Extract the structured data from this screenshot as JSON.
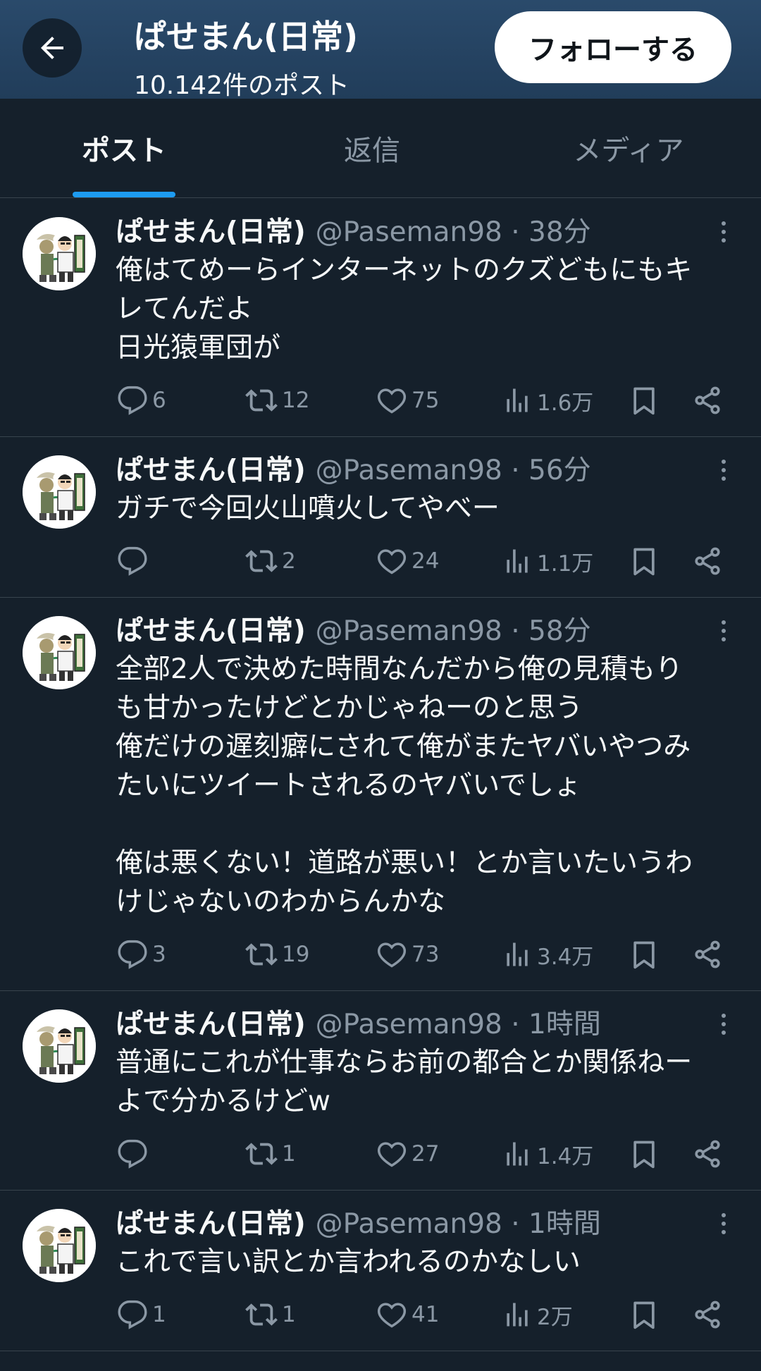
{
  "header": {
    "title": "ぱせまん(日常)",
    "subtitle": "10.142件のポスト",
    "follow_label": "フォローする"
  },
  "tabs": [
    {
      "label": "ポスト",
      "active": true
    },
    {
      "label": "返信",
      "active": false
    },
    {
      "label": "メディア",
      "active": false
    }
  ],
  "posts": [
    {
      "name": "ぱせまん(日常)",
      "handle": "@Paseman98 · 38分",
      "text": "俺はてめーらインターネットのクズどもにもキ\nレてんだよ\n日光猿軍団が",
      "replies": "6",
      "reposts": "12",
      "likes": "75",
      "views": "1.6万"
    },
    {
      "name": "ぱせまん(日常)",
      "handle": "@Paseman98 · 56分",
      "text": "ガチで今回火山噴火してやべー",
      "replies": "",
      "reposts": "2",
      "likes": "24",
      "views": "1.1万"
    },
    {
      "name": "ぱせまん(日常)",
      "handle": "@Paseman98 · 58分",
      "text": "全部2人で決めた時間なんだから俺の見積もり\nも甘かったけどとかじゃねーのと思う\n俺だけの遅刻癖にされて俺がまたヤバいやつみ\nたいにツイートされるのヤバいでしょ\n\n俺は悪くない！道路が悪い！とか言いたいうわ\nけじゃないのわからんかな",
      "replies": "3",
      "reposts": "19",
      "likes": "73",
      "views": "3.4万"
    },
    {
      "name": "ぱせまん(日常)",
      "handle": "@Paseman98 · 1時間",
      "text": "普通にこれが仕事ならお前の都合とか関係ねー\nよで分かるけどw",
      "replies": "",
      "reposts": "1",
      "likes": "27",
      "views": "1.4万"
    },
    {
      "name": "ぱせまん(日常)",
      "handle": "@Paseman98 · 1時間",
      "text": "これで言い訳とか言われるのかなしい",
      "replies": "1",
      "reposts": "1",
      "likes": "41",
      "views": "2万"
    }
  ],
  "icons": {
    "back": "arrow-left-icon",
    "more": "more-vertical-icon",
    "reply": "reply-icon",
    "repost": "repost-icon",
    "like": "heart-icon",
    "views": "analytics-icon",
    "bookmark": "bookmark-icon",
    "share": "share-icon"
  },
  "colors": {
    "background": "#15202b",
    "header": "#2a4a6b",
    "accent": "#1d9bf0",
    "muted_text": "#8b98a5",
    "divider": "#38444d"
  }
}
